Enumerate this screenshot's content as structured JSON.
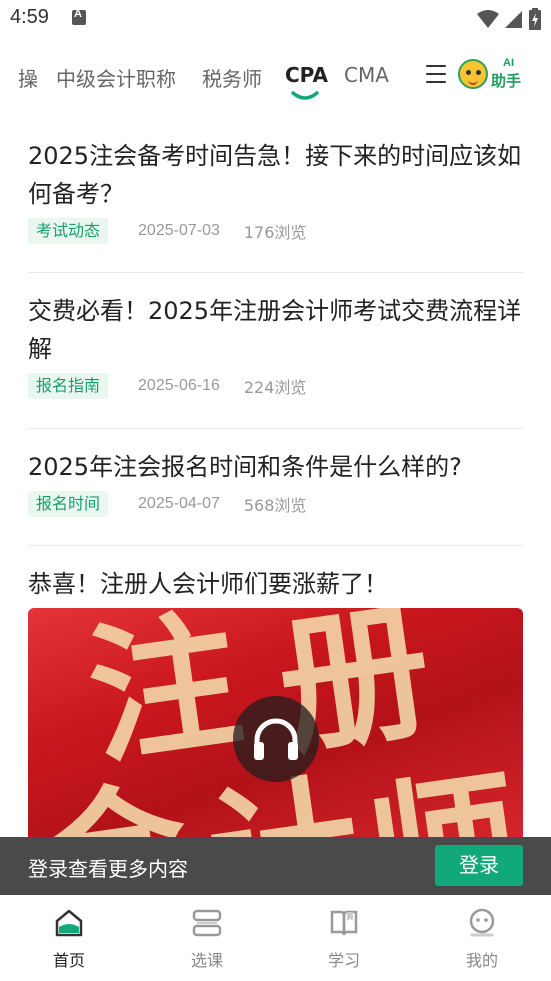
{
  "status_bar": {
    "time": "4:59",
    "icons": [
      "notification-icon",
      "wifi-icon",
      "signal-icon",
      "battery-icon"
    ]
  },
  "tabs": [
    {
      "label": "操",
      "active": false
    },
    {
      "label": "中级会计职称",
      "active": false
    },
    {
      "label": "税务师",
      "active": false
    },
    {
      "label": "CPA",
      "active": true
    },
    {
      "label": "CMA",
      "active": false
    }
  ],
  "ai_assistant": {
    "top": "AI",
    "bottom": "助手"
  },
  "articles": [
    {
      "title": "2025注会备考时间告急！接下来的时间应该如何备考？",
      "tag": "考试动态",
      "date": "2025-07-03",
      "views": "176浏览"
    },
    {
      "title": "交费必看！2025年注册会计师考试交费流程详解",
      "tag": "报名指南",
      "date": "2025-06-16",
      "views": "224浏览"
    },
    {
      "title": "2025年注会报名时间和条件是什么样的?",
      "tag": "报名时间",
      "date": "2025-04-07",
      "views": "568浏览"
    },
    {
      "title": "恭喜！注册人会计师们要涨薪了！"
    }
  ],
  "image_art": {
    "char1": "注",
    "char2": "册",
    "char3": "会",
    "char4": "计",
    "char5": "师"
  },
  "login_banner": {
    "text": "登录查看更多内容",
    "button": "登录"
  },
  "bottom_nav": [
    {
      "label": "首页",
      "icon": "home-icon",
      "active": true
    },
    {
      "label": "选课",
      "icon": "course-icon",
      "active": false
    },
    {
      "label": "学习",
      "icon": "book-icon",
      "active": false
    },
    {
      "label": "我的",
      "icon": "profile-icon",
      "active": false
    }
  ],
  "colors": {
    "accent": "#12a97a",
    "tag_bg": "#eaf7f1",
    "tag_text": "#1a9f6b",
    "banner_bg": "#4a4a4a"
  }
}
